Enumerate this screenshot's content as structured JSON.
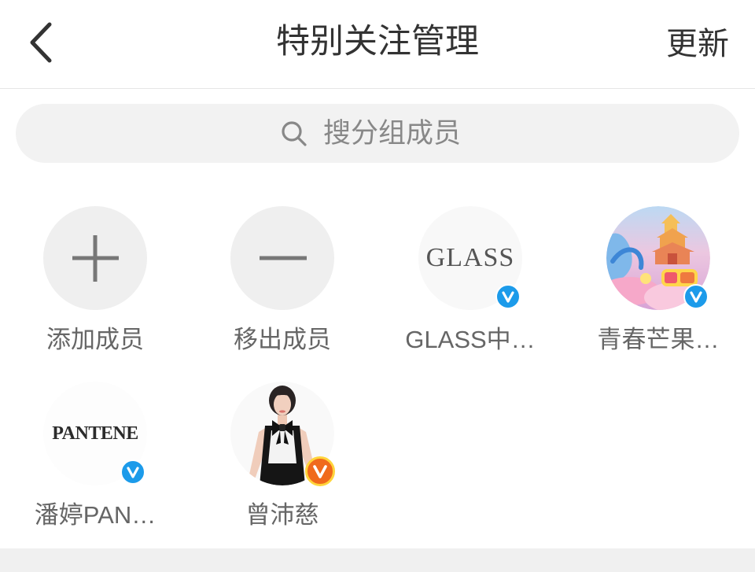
{
  "header": {
    "back_icon": "chevron-left-icon",
    "title": "特别关注管理",
    "update_label": "更新"
  },
  "search": {
    "icon": "search-icon",
    "placeholder": "搜分组成员"
  },
  "actions": [
    {
      "icon": "plus-icon",
      "label": "添加成员"
    },
    {
      "icon": "minus-icon",
      "label": "移出成员"
    }
  ],
  "members": [
    {
      "name": "GLASS中…",
      "avatar_logo_text": "GLASS",
      "verified_badge": "blue-verified-icon"
    },
    {
      "name": "青春芒果…",
      "verified_badge": "blue-verified-icon"
    },
    {
      "name": "潘婷PAN…",
      "avatar_logo_text": "PANTENE",
      "verified_badge": "blue-verified-icon"
    },
    {
      "name": "曾沛慈",
      "verified_badge": "gold-verified-icon"
    }
  ],
  "colors": {
    "text_primary": "#333333",
    "text_secondary": "#666666",
    "placeholder": "#888888",
    "divider": "#e6e6e6",
    "search_bg": "#f2f2f2",
    "action_circle_bg": "#efefef",
    "action_icon": "#777777",
    "verified_blue": "#1c9bea",
    "verified_gold": "#f06a1c",
    "footer_bg": "#f0f0f0"
  }
}
